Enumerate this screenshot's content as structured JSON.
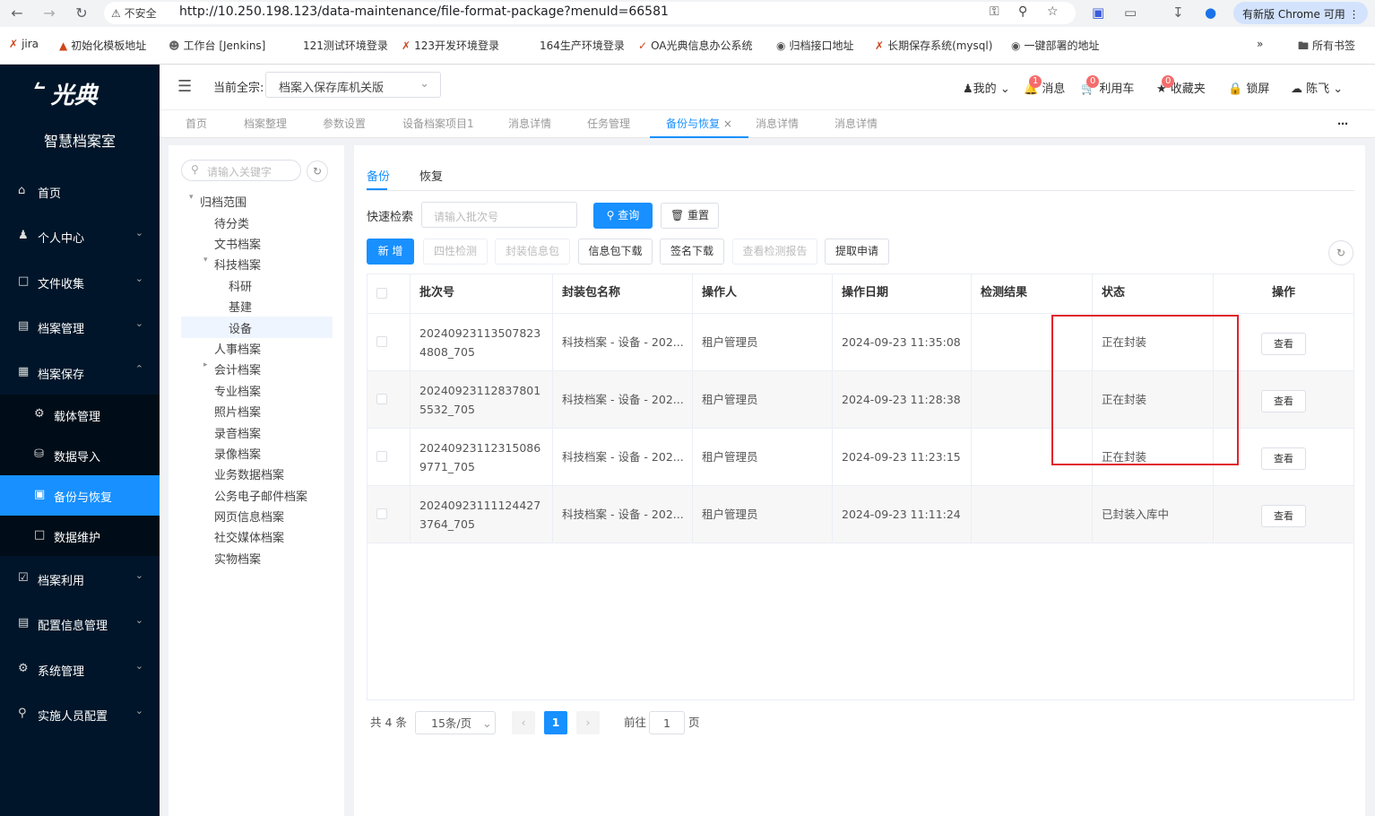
{
  "browser": {
    "security": "不安全",
    "url": "http://10.250.198.123/data-maintenance/file-format-package?menuId=66581",
    "update_label": "有新版 Chrome 可用",
    "bookmarks": [
      "jira",
      "初始化模板地址",
      "工作台 [Jenkins]",
      "121测试环境登录",
      "123开发环境登录",
      "164生产环境登录",
      "OA光典信息办公系统",
      "归档接口地址",
      "长期保存系统(mysql)",
      "一键部署的地址"
    ],
    "all_bookmarks": "所有书签"
  },
  "brand": {
    "logo": "光典",
    "system_name": "智慧档案室"
  },
  "sidebar": {
    "items": [
      {
        "label": "首页",
        "icon": "home-icon"
      },
      {
        "label": "个人中心",
        "icon": "user-icon"
      },
      {
        "label": "文件收集",
        "icon": "folder-icon"
      },
      {
        "label": "档案管理",
        "icon": "archive-icon"
      },
      {
        "label": "档案保存",
        "icon": "storage-icon"
      },
      {
        "label": "载体管理",
        "icon": "gear-icon"
      },
      {
        "label": "数据导入",
        "icon": "import-icon"
      },
      {
        "label": "备份与恢复",
        "icon": "backup-icon"
      },
      {
        "label": "数据维护",
        "icon": "folder-icon"
      },
      {
        "label": "档案利用",
        "icon": "check-icon"
      },
      {
        "label": "配置信息管理",
        "icon": "config-icon"
      },
      {
        "label": "系统管理",
        "icon": "gear-icon"
      },
      {
        "label": "实施人员配置",
        "icon": "wrench-icon"
      }
    ]
  },
  "header": {
    "fonds_label": "当前全宗:",
    "fonds_value": "档案入保存库机关版",
    "my": "我的",
    "messages": "消息",
    "messages_badge": "1",
    "cart": "利用车",
    "cart_badge": "0",
    "favorites": "收藏夹",
    "favorites_badge": "0",
    "lock": "锁屏",
    "user": "陈飞"
  },
  "tabs": [
    "首页",
    "档案整理",
    "参数设置",
    "设备档案项目1",
    "消息详情",
    "任务管理",
    "备份与恢复",
    "消息详情",
    "消息详情"
  ],
  "tree": {
    "search_placeholder": "请输入关键字",
    "nodes": [
      "归档范围",
      "待分类",
      "文书档案",
      "科技档案",
      "科研",
      "基建",
      "设备",
      "人事档案",
      "会计档案",
      "专业档案",
      "照片档案",
      "录音档案",
      "录像档案",
      "业务数据档案",
      "公务电子邮件档案",
      "网页信息档案",
      "社交媒体档案",
      "实物档案"
    ]
  },
  "main": {
    "tabs": [
      "备份",
      "恢复"
    ],
    "quick_search_label": "快速检索",
    "batch_placeholder": "请输入批次号",
    "query_button": "查询",
    "reset_button": "重置",
    "buttons": [
      "新 增",
      "四性检测",
      "封装信息包",
      "信息包下载",
      "签名下载",
      "查看检测报告",
      "提取申请"
    ],
    "columns": [
      "批次号",
      "封装包名称",
      "操作人",
      "操作日期",
      "检测结果",
      "状态",
      "操作"
    ],
    "rows": [
      {
        "batch": "202409231135078234808_705",
        "name": "科技档案 - 设备 - 202...",
        "operator": "租户管理员",
        "date": "2024-09-23 11:35:08",
        "result": "",
        "status": "正在封装",
        "action": "查看"
      },
      {
        "batch": "202409231128378015532_705",
        "name": "科技档案 - 设备 - 202...",
        "operator": "租户管理员",
        "date": "2024-09-23 11:28:38",
        "result": "",
        "status": "正在封装",
        "action": "查看"
      },
      {
        "batch": "202409231123150869771_705",
        "name": "科技档案 - 设备 - 202...",
        "operator": "租户管理员",
        "date": "2024-09-23 11:23:15",
        "result": "",
        "status": "正在封装",
        "action": "查看"
      },
      {
        "batch": "202409231111244273764_705",
        "name": "科技档案 - 设备 - 202...",
        "operator": "租户管理员",
        "date": "2024-09-23 11:11:24",
        "result": "",
        "status": "已封装入库中",
        "action": "查看"
      }
    ],
    "pager": {
      "total": "共 4 条",
      "page_size": "15条/页",
      "current_page": "1",
      "goto_label": "前往",
      "goto_value": "1",
      "page_unit": "页"
    }
  },
  "colors": {
    "accent": "#1890ff",
    "sidebar_bg": "#001529",
    "highlight_box": "#e0212c"
  }
}
